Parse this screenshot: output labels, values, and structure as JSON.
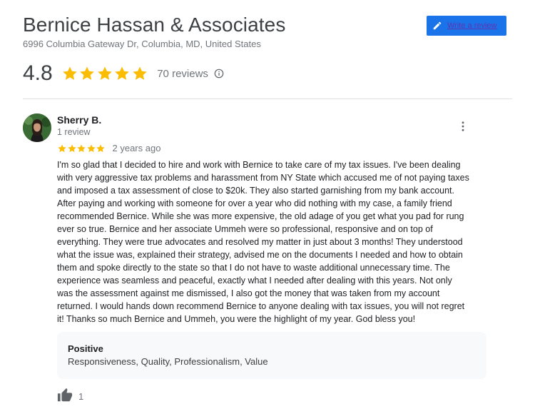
{
  "business": {
    "name": "Bernice Hassan & Associates",
    "address": "6996 Columbia Gateway Dr, Columbia, MD, United States",
    "rating": "4.8",
    "star_count": 5,
    "reviews_count": "70 reviews",
    "write_review_label": "Write a review"
  },
  "review": {
    "author": "Sherry B.",
    "author_meta": "1 review",
    "stars": 5,
    "date": "2 years ago",
    "text_lines": [
      "I'm so glad that I decided to hire and work with Bernice to take care of my tax issues. I've been dealing",
      "with very aggressive tax problems and harassment from NY State which accused me of not paying taxes",
      "and imposed a tax assessment of close to $20k. They also started garnishing from my bank account.",
      "After paying and working with someone for over a year who did nothing with my case, a family friend",
      "recommended Bernice. While she was more expensive, the old adage of you get what you pad for rung",
      "ever so true. Bernice and her associate Ummeh were so professional, responsive and on top of",
      "everything. They were true advocates and resolved my matter in just about 3 months! They understood",
      "what the issue was, explained their strategy, advised me on the documents I needed and how to obtain",
      "them and spoke directly to the state so that I do not have to waste additional unnecessary time. The",
      "experience was seamless and peaceful, exactly what I needed after dealing with this years. Not only",
      "was the assessment against me dismissed, I also got the money that was taken from my account",
      "returned.  I would hands down recommend Bernice to anyone dealing with tax issues, you will not regret",
      "it! Thanks so much Bernice and Ummeh, you were the highlight of my year. God bless you!"
    ],
    "highlights_title": "Positive",
    "highlights_values": "Responsiveness, Quality, Professionalism, Value",
    "likes": "1"
  },
  "colors": {
    "star": "#fbbc04",
    "button_bg": "#1a73e8",
    "button_text": "#5e35b1"
  },
  "icons": {
    "write": "pencil-icon",
    "info": "info-icon",
    "more": "more-vert-icon",
    "like": "thumb-up-icon"
  }
}
